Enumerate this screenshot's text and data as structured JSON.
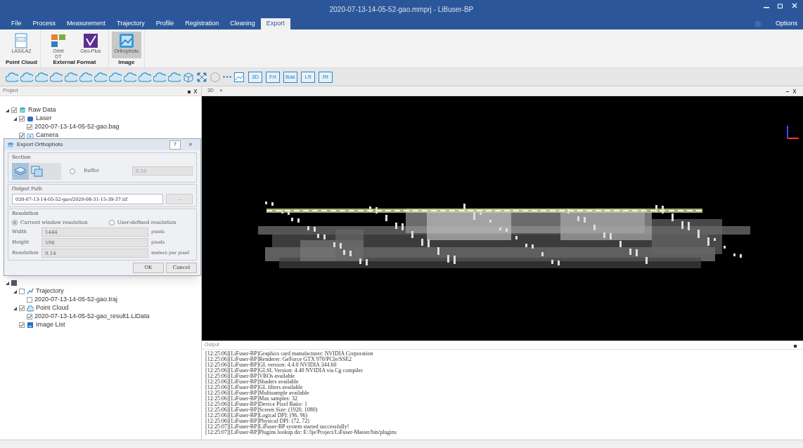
{
  "window": {
    "title": "2020-07-13-14-05-52-gao.mmprj - LiBuser-BP",
    "options": "Options"
  },
  "tabs": [
    {
      "label": "File",
      "selected": false
    },
    {
      "label": "Process",
      "selected": false
    },
    {
      "label": "Measurement",
      "selected": false
    },
    {
      "label": "Trajectory",
      "selected": false
    },
    {
      "label": "Profile",
      "selected": false
    },
    {
      "label": "Registration",
      "selected": false
    },
    {
      "label": "Cleaning",
      "selected": false
    },
    {
      "label": "Export",
      "selected": true
    }
  ],
  "ribbon_groups": [
    {
      "title": "Point Cloud",
      "buttons": [
        {
          "label": "LAS/LAZ",
          "kind": "las",
          "selected": false
        }
      ]
    },
    {
      "title": "External Format",
      "buttons": [
        {
          "label": "Orbit\nDT",
          "kind": "orbit",
          "selected": false
        },
        {
          "label": "Geo-Plus",
          "kind": "geoplus",
          "selected": false
        }
      ]
    },
    {
      "title": "Image",
      "buttons": [
        {
          "label": "Orthophoto",
          "kind": "ortho",
          "selected": true
        }
      ]
    }
  ],
  "view_buttons": [
    "3D",
    "Frt",
    "Bak",
    "Lft",
    "Rt"
  ],
  "project_panel": {
    "title": "Project",
    "tree": [
      {
        "label": "Raw Data",
        "checked": true,
        "kind": "data",
        "children": [
          {
            "label": "Laser",
            "checked": true,
            "kind": "laser",
            "children": [
              {
                "label": "2020-07-13-14-05-52-gao.bag",
                "checked": true
              }
            ]
          },
          {
            "label": "Camera",
            "checked": true,
            "kind": "camera"
          }
        ]
      }
    ],
    "tree_lower": [
      {
        "label": "Trajectory",
        "checked": false,
        "kind": "trajectory",
        "children": [
          {
            "label": "2020-07-13-14-05-52-gao.traj",
            "checked": false
          }
        ]
      },
      {
        "label": "Point Cloud",
        "checked": true,
        "kind": "cloud",
        "children": [
          {
            "label": "2020-07-13-14-05-52-gao_result1.LiData",
            "checked": true
          }
        ]
      },
      {
        "label": "Image List",
        "checked": true,
        "kind": "image"
      }
    ]
  },
  "dialog": {
    "title": "Export Orthophoto",
    "help": "?",
    "close": "✕",
    "section": {
      "title": "Section",
      "buffer_label": "Buffer",
      "buffer_checked": false,
      "buffer_value": "0.50"
    },
    "output_path": {
      "title": "Output Path",
      "value": "020-07-13-14-05-52-gao/2020-08-31-15-39-37.tif",
      "browse": "..."
    },
    "resolution": {
      "title": "Resolution",
      "options": [
        {
          "label": "Current window resolution",
          "selected": true
        },
        {
          "label": "User-defined resolution",
          "selected": false
        }
      ],
      "fields": [
        {
          "label": "Width",
          "value": "1444",
          "unit": "pixels"
        },
        {
          "label": "Height",
          "value": "598",
          "unit": "pixels"
        },
        {
          "label": "Resolution",
          "value": "0.14",
          "unit": "meters per pixel"
        }
      ]
    },
    "buttons": [
      "OK",
      "Cancel"
    ]
  },
  "view_tab": {
    "label": "3D",
    "close": "✕"
  },
  "output": {
    "title": "Output",
    "lines": [
      "[12:25:06][LiFuser-BP]Graphics card manufacturer: NVIDIA Corporation",
      "[12:25:06][LiFuser-BP]Renderer: GeForce GTX 970/PCIe/SSE2",
      "[12:25:06][LiFuser-BP]GL version: 4.4.0 NVIDIA 344.60",
      "[12:25:06][LiFuser-BP]GLSL Version: 4.40 NVIDIA via Cg compiler",
      "[12:25:06][LiFuser-BP]VBOs available",
      "[12:25:06][LiFuser-BP]Shaders available",
      "[12:25:06][LiFuser-BP]GL filters available",
      "[12:25:06][LiFuser-BP]Multisample available",
      "[12:25:06][LiFuser-BP]Max samples: 32",
      "[12:25:06][LiFuser-BP]Device Pixel Ratio: 1",
      "[12:25:06][LiFuser-BP]Screen Size: (1920, 1080)",
      "[12:25:06][LiFuser-BP]Logical DPI: (96, 96)",
      "[12:25:06][LiFuser-BP]Physical DPI: (72, 72)",
      "[12:25:07][LiFuser-BP]LiFuser-BP system started successfully!",
      "[12:25:07][LiFuser-BP]Plugins lookup dir: E:/lje/Project/LiFuser-Master/bin/plugins"
    ]
  }
}
